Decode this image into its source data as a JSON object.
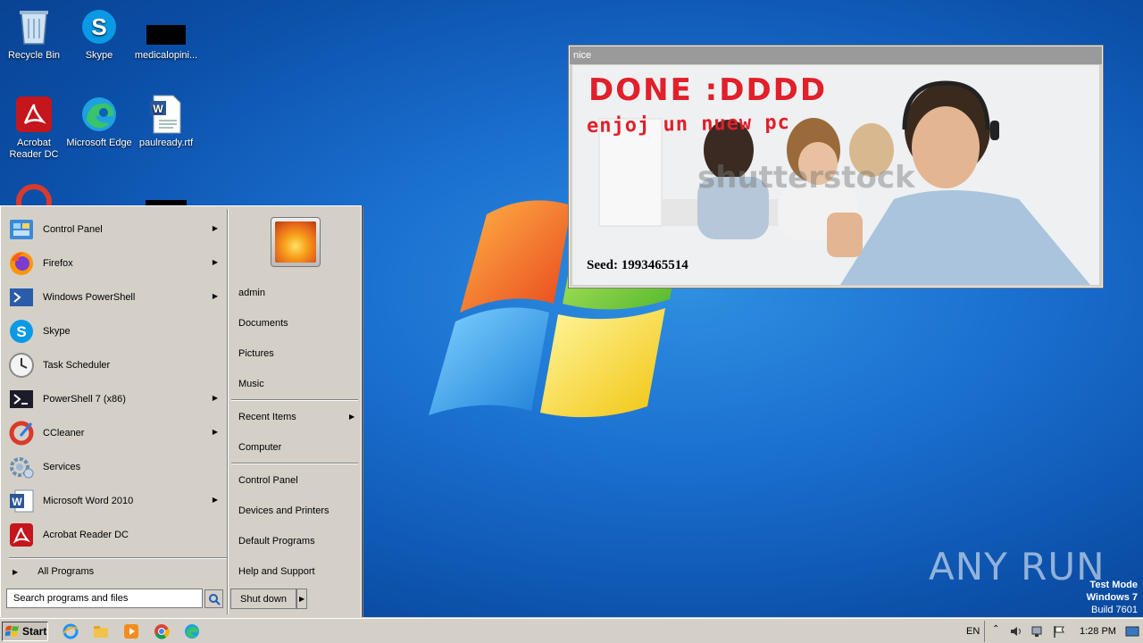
{
  "desktop_icons": [
    {
      "label": "Recycle Bin",
      "icon": "recycle-bin-icon"
    },
    {
      "label": "Skype",
      "icon": "skype-icon"
    },
    {
      "label": "medicalopini...",
      "icon": "file-black-icon"
    },
    {
      "label": "Acrobat Reader DC",
      "icon": "acrobat-icon"
    },
    {
      "label": "Microsoft Edge",
      "icon": "edge-icon"
    },
    {
      "label": "paulready.rtf",
      "icon": "word-doc-icon"
    }
  ],
  "popup": {
    "title": "nice",
    "headline": "DONE :DDDD",
    "subline": "enjoj un nuew pc",
    "watermark": "shutterstock",
    "seed": "Seed: 1993465514"
  },
  "start_menu": {
    "left_items": [
      {
        "label": "Control Panel",
        "icon": "control-panel-icon",
        "submenu": true
      },
      {
        "label": "Firefox",
        "icon": "firefox-icon",
        "submenu": true
      },
      {
        "label": "Windows PowerShell",
        "icon": "powershell-icon",
        "submenu": true
      },
      {
        "label": "Skype",
        "icon": "skype-icon",
        "submenu": false
      },
      {
        "label": "Task Scheduler",
        "icon": "clock-icon",
        "submenu": false
      },
      {
        "label": "PowerShell 7 (x86)",
        "icon": "powershell7-icon",
        "submenu": true
      },
      {
        "label": "CCleaner",
        "icon": "ccleaner-icon",
        "submenu": true
      },
      {
        "label": "Services",
        "icon": "gear-icon",
        "submenu": false
      },
      {
        "label": "Microsoft Word 2010",
        "icon": "word-icon",
        "submenu": true
      },
      {
        "label": "Acrobat Reader DC",
        "icon": "acrobat-icon",
        "submenu": false
      }
    ],
    "all_programs": "All Programs",
    "search_placeholder": "Search programs and files",
    "right_items": [
      {
        "label": "admin"
      },
      {
        "label": "Documents"
      },
      {
        "label": "Pictures"
      },
      {
        "label": "Music"
      },
      {
        "label": "Recent Items",
        "submenu": true
      },
      {
        "label": "Computer"
      },
      {
        "label": "Control Panel"
      },
      {
        "label": "Devices and Printers"
      },
      {
        "label": "Default Programs"
      },
      {
        "label": "Help and Support"
      }
    ],
    "shutdown_label": "Shut down"
  },
  "taskbar": {
    "start_label": "Start",
    "pinned": [
      "ie-icon",
      "explorer-icon",
      "media-player-icon",
      "chrome-icon",
      "edge-icon"
    ],
    "language": "EN",
    "clock": "1:28 PM"
  },
  "overlay": {
    "anyrun": "ANY RUN",
    "test_mode": "Test Mode",
    "os": "Windows 7",
    "build": "Build 7601"
  },
  "colors": {
    "accent_red": "#e0202a",
    "classic_gray": "#d4d0c8",
    "desktop_blue": "#1a6fcf"
  }
}
